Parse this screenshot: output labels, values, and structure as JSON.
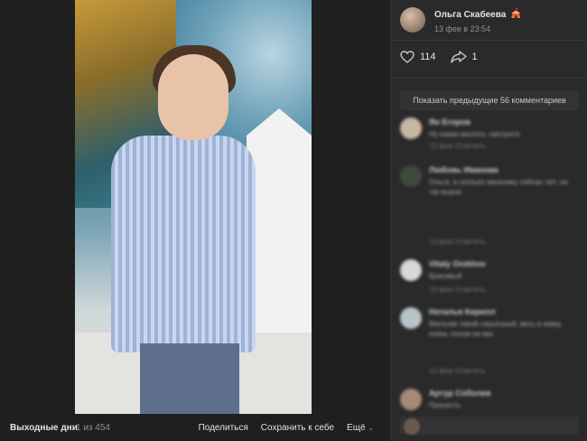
{
  "viewer": {
    "album_title": "Выходные дни",
    "counter": "1 из 454",
    "actions": {
      "share": "Поделиться",
      "save": "Сохранить к себе",
      "more": "Ещё"
    }
  },
  "panel": {
    "author": {
      "name": "Ольга Скабеева",
      "date": "13 фев в 23:54"
    },
    "likes": "114",
    "shares": "1",
    "show_previous": "Показать предыдущие 56 комментариев",
    "comments": [
      {
        "name": "Ян Егоров",
        "text": "Ну какая милота, смотрите",
        "meta": "13 фев  Ответить"
      },
      {
        "name": "Любовь Иванова",
        "text": "Ольга, а сколько мальчику сейчас лет, он так вырос",
        "meta": "13 фев  Ответить"
      },
      {
        "name": "Vitaly Orekhov",
        "text": "Красивый",
        "meta": "13 фев  Ответить"
      },
      {
        "name": "Наталья Кирилл",
        "text": "Мальчик такой серьёзный, весь в маму, очень похож на вас",
        "meta": "13 фев  Ответить"
      },
      {
        "name": "Артур Соболев",
        "text": "Прелесть",
        "meta": ""
      }
    ]
  },
  "colors": {
    "background": "#1e1e1e",
    "panel": "#2a2a2b",
    "text": "#e1e3e6",
    "muted": "#8c8f94"
  }
}
